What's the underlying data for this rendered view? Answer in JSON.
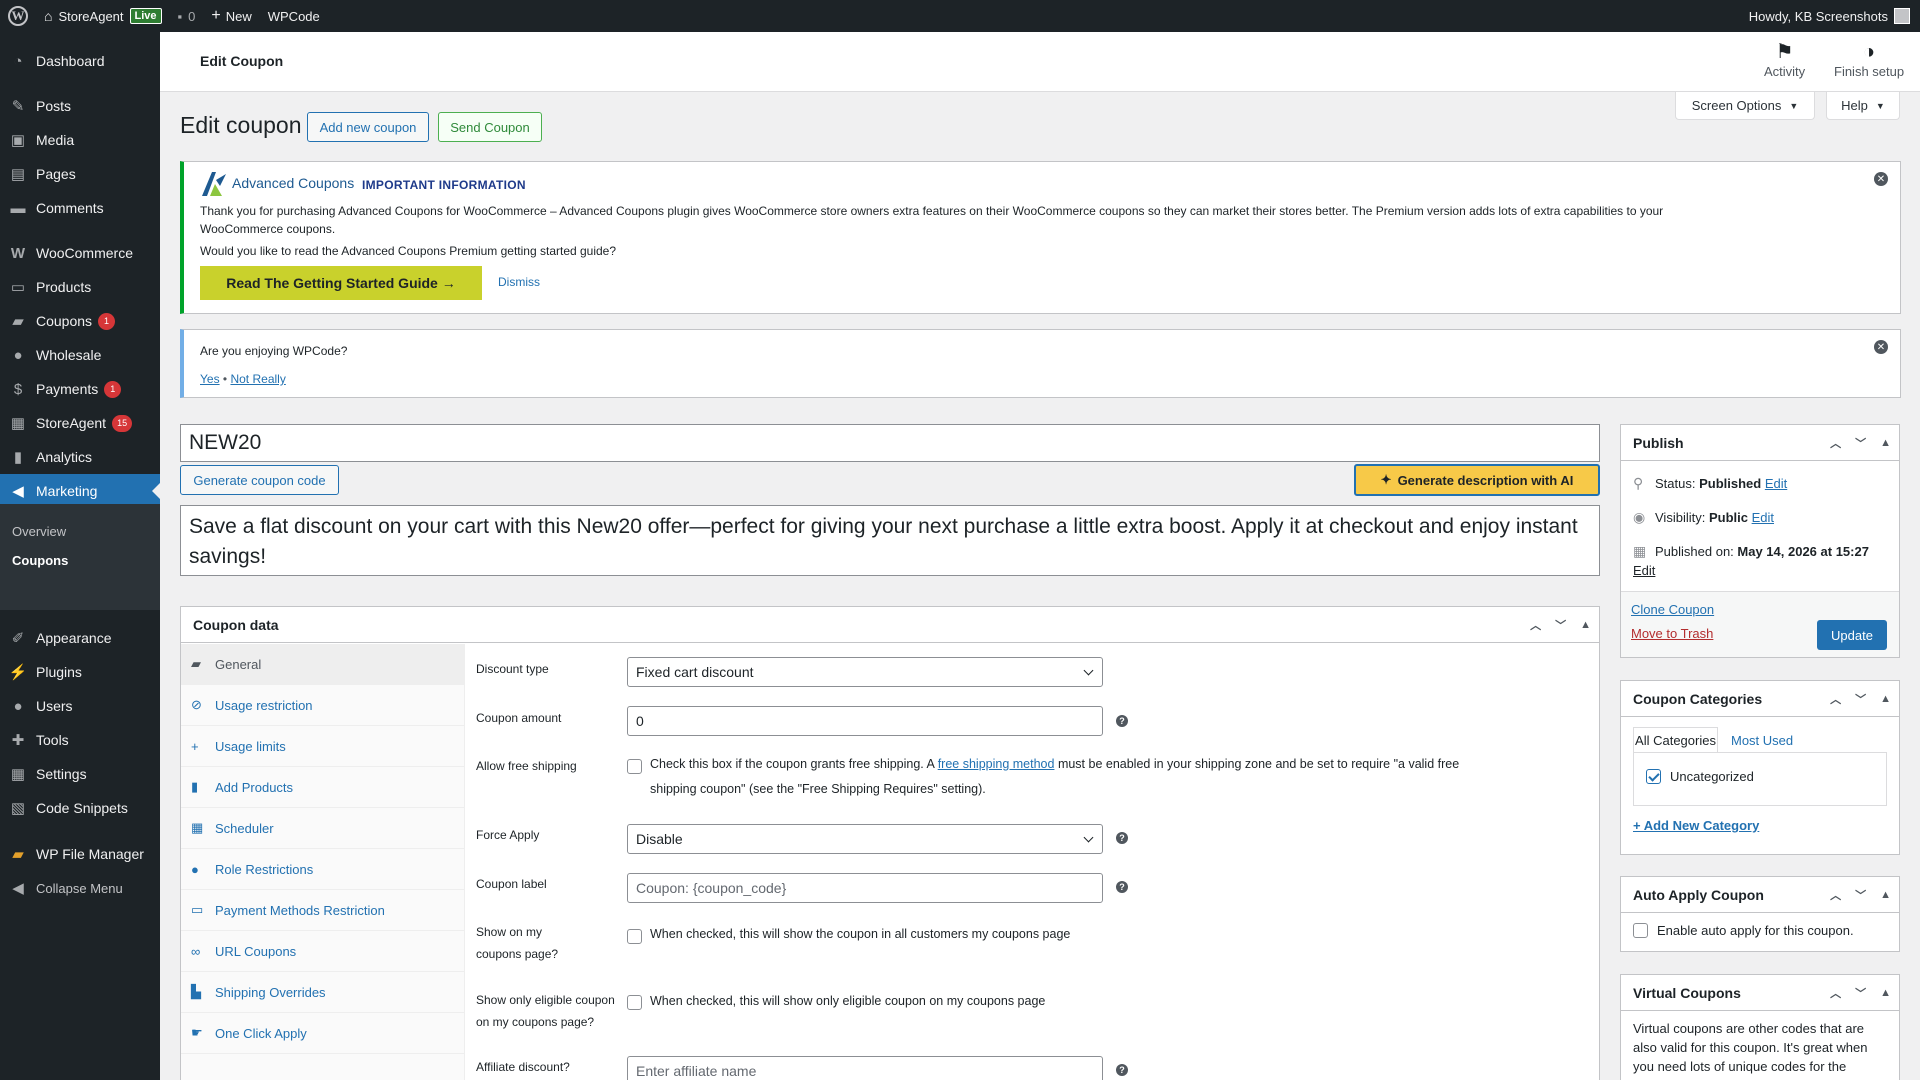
{
  "adminbar": {
    "site_name": "StoreAgent",
    "live_badge": "Live",
    "comments_count": "0",
    "new_label": "New",
    "wpcode_label": "WPCode",
    "howdy": "Howdy, KB Screenshots"
  },
  "sidebar": {
    "items": [
      {
        "label": "Dashboard",
        "icon": "dashboard-icon"
      },
      {
        "label": "Posts",
        "icon": "pin-icon"
      },
      {
        "label": "Media",
        "icon": "media-icon"
      },
      {
        "label": "Pages",
        "icon": "pages-icon"
      },
      {
        "label": "Comments",
        "icon": "comment-icon"
      },
      {
        "label": "WooCommerce",
        "icon": "woo-icon"
      },
      {
        "label": "Products",
        "icon": "archive-icon"
      },
      {
        "label": "Coupons",
        "icon": "ticket-icon",
        "badge": "1"
      },
      {
        "label": "Wholesale",
        "icon": "wholesale-icon"
      },
      {
        "label": "Payments",
        "icon": "dollar-icon",
        "badge": "1"
      },
      {
        "label": "StoreAgent",
        "icon": "table-icon",
        "badge": "15"
      },
      {
        "label": "Analytics",
        "icon": "bar-chart-icon"
      },
      {
        "label": "Marketing",
        "icon": "megaphone-icon"
      },
      {
        "label": "Appearance",
        "icon": "brush-icon"
      },
      {
        "label": "Plugins",
        "icon": "plug-icon"
      },
      {
        "label": "Users",
        "icon": "user-icon"
      },
      {
        "label": "Tools",
        "icon": "wrench-icon"
      },
      {
        "label": "Settings",
        "icon": "settings-icon"
      },
      {
        "label": "Code Snippets",
        "icon": "code-icon"
      },
      {
        "label": "WP File Manager",
        "icon": "folder-icon"
      },
      {
        "label": "Collapse Menu",
        "icon": "collapse-icon"
      }
    ],
    "submenu": {
      "overview": "Overview",
      "coupons": "Coupons"
    }
  },
  "header": {
    "title": "Edit Coupon",
    "activity": "Activity",
    "finish_setup": "Finish setup",
    "screen_options": "Screen Options",
    "help": "Help"
  },
  "page": {
    "heading": "Edit coupon",
    "add_new": "Add new coupon",
    "send_coupon": "Send Coupon"
  },
  "notice_acfw": {
    "brand": "Advanced Coupons",
    "title": "IMPORTANT INFORMATION",
    "text1": "Thank you for purchasing Advanced Coupons for WooCommerce – Advanced Coupons plugin gives WooCommerce store owners extra features on their WooCommerce coupons so they can market their stores better. The Premium version adds lots of extra capabilities to your",
    "text2": "WooCommerce coupons.",
    "text3": "Would you like to read the Advanced Coupons Premium getting started guide?",
    "button": "Read The Getting Started Guide →",
    "dismiss": "Dismiss"
  },
  "notice_wpcode": {
    "question": "Are you enjoying WPCode?",
    "yes": "Yes",
    "sep": "•",
    "no": "Not Really"
  },
  "coupon": {
    "code": "NEW20",
    "generate_code": "Generate coupon code",
    "generate_ai": "Generate description with AI",
    "description": "Save a flat discount on your cart with this New20 offer—perfect for giving your next purchase a little extra boost. Apply it at checkout and enjoy instant savings!"
  },
  "coupon_data": {
    "title": "Coupon data",
    "tabs": [
      {
        "label": "General",
        "icon": "ticket-icon"
      },
      {
        "label": "Usage restriction",
        "icon": "block-icon"
      },
      {
        "label": "Usage limits",
        "icon": "plus-icon"
      },
      {
        "label": "Add Products",
        "icon": "bag-icon"
      },
      {
        "label": "Scheduler",
        "icon": "calendar-icon"
      },
      {
        "label": "Role Restrictions",
        "icon": "person-icon"
      },
      {
        "label": "Payment Methods Restriction",
        "icon": "card-icon"
      },
      {
        "label": "URL Coupons",
        "icon": "link-icon"
      },
      {
        "label": "Shipping Overrides",
        "icon": "truck-icon"
      },
      {
        "label": "One Click Apply",
        "icon": "pointer-icon"
      }
    ],
    "fields": {
      "discount_type_label": "Discount type",
      "discount_type_value": "Fixed cart discount",
      "amount_label": "Coupon amount",
      "amount_value": "0",
      "free_shipping_label": "Allow free shipping",
      "free_shipping_text_a": "Check this box if the coupon grants free shipping. A",
      "free_shipping_link": "free shipping method",
      "free_shipping_text_b": "must be enabled in your shipping zone and be set to require \"a valid free",
      "free_shipping_text_c": "shipping coupon\" (see the \"Free Shipping Requires\" setting).",
      "force_apply_label": "Force Apply",
      "force_apply_value": "Disable",
      "coupon_label_label": "Coupon label",
      "coupon_label_placeholder": "Coupon: {coupon_code}",
      "show_my_coupons_label_1": "Show on my",
      "show_my_coupons_label_2": "coupons page?",
      "show_my_coupons_text": "When checked, this will show the coupon in all customers my coupons page",
      "show_eligible_label_1": "Show only eligible coupon",
      "show_eligible_label_2": "on my coupons page?",
      "show_eligible_text": "When checked, this will show only eligible coupon on my coupons page",
      "affiliate_label": "Affiliate discount?",
      "affiliate_placeholder": "Enter affiliate name"
    }
  },
  "publish": {
    "title": "Publish",
    "status_label": "Status:",
    "status_value": "Published",
    "visibility_label": "Visibility:",
    "visibility_value": "Public",
    "published_on_label": "Published on:",
    "published_on_value": "May 14, 2026 at 15:27",
    "edit": "Edit",
    "clone": "Clone Coupon",
    "trash": "Move to Trash",
    "update": "Update"
  },
  "categories": {
    "title": "Coupon Categories",
    "tab_all": "All Categories",
    "tab_used": "Most Used",
    "item": "Uncategorized",
    "add_new": "+ Add New Category"
  },
  "auto_apply": {
    "title": "Auto Apply Coupon",
    "text": "Enable auto apply for this coupon."
  },
  "virtual": {
    "title": "Virtual Coupons",
    "line1": "Virtual coupons are other codes that are",
    "line2": "also valid for this coupon. It's great when",
    "line3": "you need lots of unique codes for the"
  },
  "colors": {
    "admin_dark": "#1d2327",
    "accent": "#2271b1",
    "badge_red": "#d63638",
    "guide_yellow": "#c9d12c",
    "ai_yellow": "#f7c948"
  }
}
